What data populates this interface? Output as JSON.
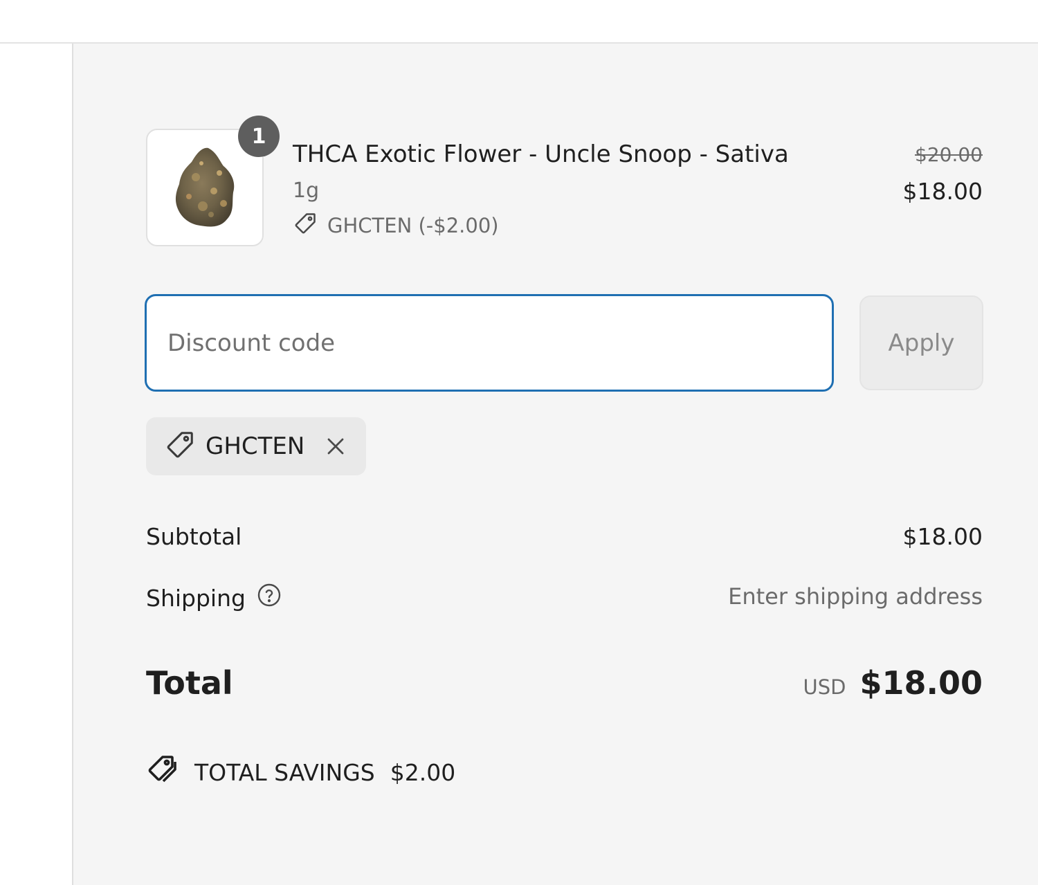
{
  "cart": {
    "item": {
      "quantity": "1",
      "title": "THCA Exotic Flower - Uncle Snoop - Sativa",
      "variant": "1g",
      "discount_line": "GHCTEN (-$2.00)",
      "original_price": "$20.00",
      "final_price": "$18.00"
    }
  },
  "discount": {
    "placeholder": "Discount code",
    "value": "",
    "apply_label": "Apply",
    "applied_code": "GHCTEN"
  },
  "totals": {
    "subtotal_label": "Subtotal",
    "subtotal_value": "$18.00",
    "shipping_label": "Shipping",
    "shipping_value": "Enter shipping address",
    "total_label": "Total",
    "currency": "USD",
    "total_value": "$18.00",
    "savings_label": "TOTAL SAVINGS",
    "savings_value": "$2.00"
  },
  "icons": {
    "tag": "tag-icon",
    "close": "close-icon",
    "help": "help-circle-icon",
    "savings": "discount-tags-icon"
  },
  "colors": {
    "panel_background": "#f5f5f5",
    "focus_border": "#1f6fb2",
    "muted_text": "#6b6b6b",
    "badge": "#5e5e5e"
  }
}
